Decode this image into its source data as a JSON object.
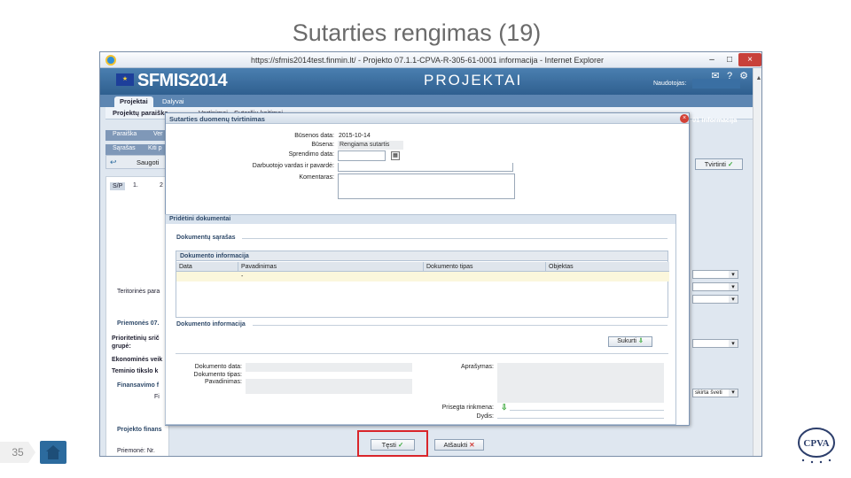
{
  "slide": {
    "title": "Sutarties rengimas (19)",
    "page_number": "35"
  },
  "browser": {
    "title": "https://sfmis2014test.finmin.lt/ - Projekto 07.1.1-CPVA-R-305-61-0001 informacija - Internet Explorer",
    "min": "–",
    "max": "□",
    "close": "×"
  },
  "app": {
    "logo_text": "SFMIS2014",
    "module": "PROJEKTAI",
    "user_label": "Naudotojas:",
    "tabs": [
      "Projektai",
      "Dalyvai"
    ],
    "subnav": [
      "Projektų paraiška",
      "Vertinimai",
      "Sutarčių keitimai"
    ],
    "subnav_right": "01 informacija",
    "bg_tabs": [
      "Paraiška",
      "Ver",
      "Sąrašas",
      "Kiti p"
    ],
    "save_label": "Saugoti",
    "bg_tabs2": [
      "S/P",
      "1.",
      "2"
    ],
    "bg_labels": [
      "Teritorinės para",
      "Priemonės 07.",
      "Prioritetinių srič",
      "grupė:",
      "Ekonominės veik",
      "Teminio tikslo k",
      "Finansavimo f",
      "Fi",
      "Projekto finans",
      "Priemonė: Nr."
    ],
    "bg_right_select": "skirta šveti",
    "tvirtinti_label": "Tvirtinti"
  },
  "modal": {
    "title": "Sutarties duomenų tvirtinimas",
    "fields": {
      "busenos_data_label": "Būsenos data:",
      "busenos_data_value": "2015-10-14",
      "busena_label": "Būsena:",
      "busena_value": "Rengiama sutartis",
      "sprendimo_data_label": "Sprendimo data:",
      "darbuotojo_label": "Darbuotojo vardas ir pavardė:",
      "komentaras_label": "Komentaras:"
    },
    "attached_docs": {
      "title": "Pridėtini dokumentai",
      "list_group": "Dokumentų sąrašas",
      "table_caption": "Dokumento informacija",
      "columns": [
        "Data",
        "Pavadinimas",
        "Dokumento tipas",
        "Objektas"
      ],
      "row": [
        "",
        "-",
        "",
        ""
      ],
      "info_group": "Dokumento informacija",
      "sukurti_label": "Sukurti",
      "doc_data_label": "Dokumento data:",
      "doc_tipas_label": "Dokumento tipas:",
      "pavadinimas_label": "Pavadinimas:",
      "aprasymas_label": "Aprašymas:",
      "prisegta_label": "Prisegta rinkmena:",
      "dydis_label": "Dydis:"
    },
    "tesnti_label": "Tęsti",
    "atsaukti_label": "Atšaukti"
  },
  "cpva": {
    "logo_text": "CPVA"
  },
  "colors": {
    "highlight": "#d9252a",
    "header_blue": "#2f5f8f",
    "accent_green": "#3aa83a"
  }
}
